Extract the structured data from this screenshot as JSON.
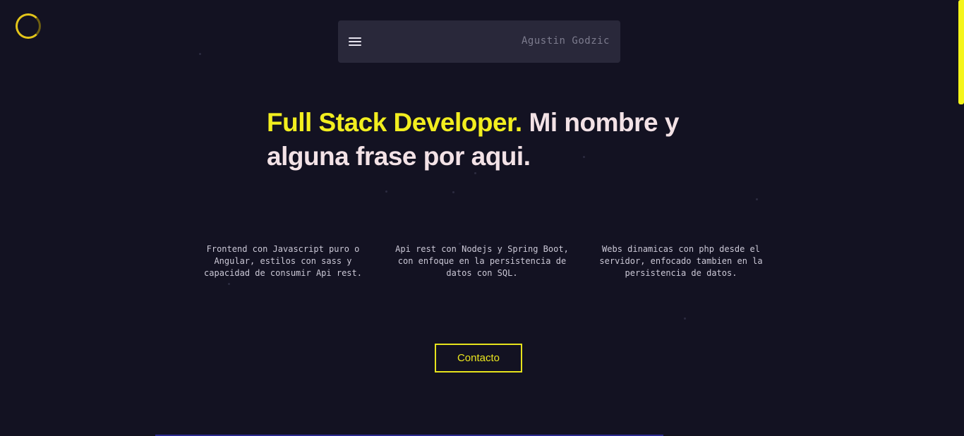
{
  "navbar": {
    "menu_icon": "hamburger-menu-icon",
    "brand_name": "Agustin Godzic"
  },
  "hero": {
    "headline_highlight": "Full Stack Developer.",
    "headline_rest": " Mi nombre y alguna frase por aqui."
  },
  "services": [
    {
      "text": "Frontend con Javascript puro o Angular, estilos con sass y capacidad de consumir Api rest."
    },
    {
      "text": "Api rest con Nodejs y Spring Boot, con enfoque en la persistencia de datos con SQL."
    },
    {
      "text": "Webs dinamicas con php desde el servidor, enfocado tambien en la persistencia de datos."
    }
  ],
  "contact_button": {
    "label": "Contacto"
  },
  "loader_icon": "loading-ring-icon",
  "colors": {
    "background": "#131222",
    "navbar": "#29283a",
    "accent": "#f2ee1f",
    "headline_text": "#f3e2e6",
    "body_text": "#cbc8d6",
    "brand_text": "#7d7c8e"
  }
}
